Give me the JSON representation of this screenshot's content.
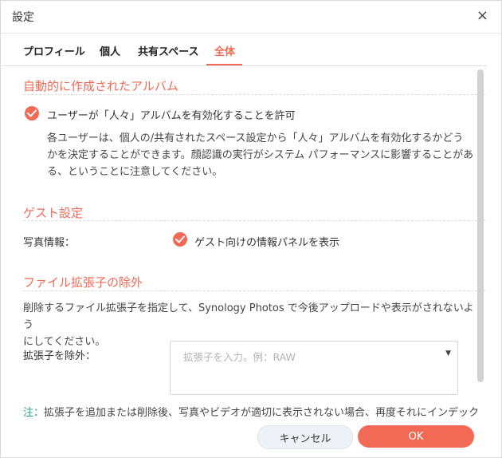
{
  "dialog": {
    "title": "設定",
    "close_icon": "×"
  },
  "tabs": [
    {
      "label": "プロフィール",
      "active": false
    },
    {
      "label": "個人",
      "active": false
    },
    {
      "label": "共有スペース",
      "active": false
    },
    {
      "label": "全体",
      "active": true
    }
  ],
  "sections": {
    "auto_album": {
      "title": "自動的に作成されたアルバム",
      "checkbox_label": "ユーザーが「人々」アルバムを有効化することを許可",
      "checked": true,
      "desc_line1": "各ユーザーは、個人の/共有されたスペース設定から「人々」アルバムを有効化するかどう",
      "desc_line2": "かを決定することができます。顔認識の実行がシステム パフォーマンスに影響することがあ",
      "desc_line3": "る、ということに注意してください。"
    },
    "guest": {
      "title": "ゲスト設定",
      "photo_info_label": "写真情報：",
      "checkbox_label": "ゲスト向けの情報パネルを表示",
      "checked": true
    },
    "ext": {
      "title": "ファイル拡張子の除外",
      "desc_line1": "削除するファイル拡張子を指定して、Synology Photos で今後アップロードや表示がされないよう",
      "desc_line2": "にしてください。",
      "field_label": "拡張子を除外：",
      "placeholder": "拡張子を入力。例：RAW",
      "caret": "▼"
    },
    "note": {
      "label": "注：",
      "text": "拡張子を追加または削除後、写真やビデオが適切に表示されない場合、再度それにインデック"
    }
  },
  "footer": {
    "cancel_label": "キャンセル",
    "ok_label": "OK"
  },
  "colors": {
    "accent": "#f26a55",
    "note_label": "#2a9d8f"
  }
}
